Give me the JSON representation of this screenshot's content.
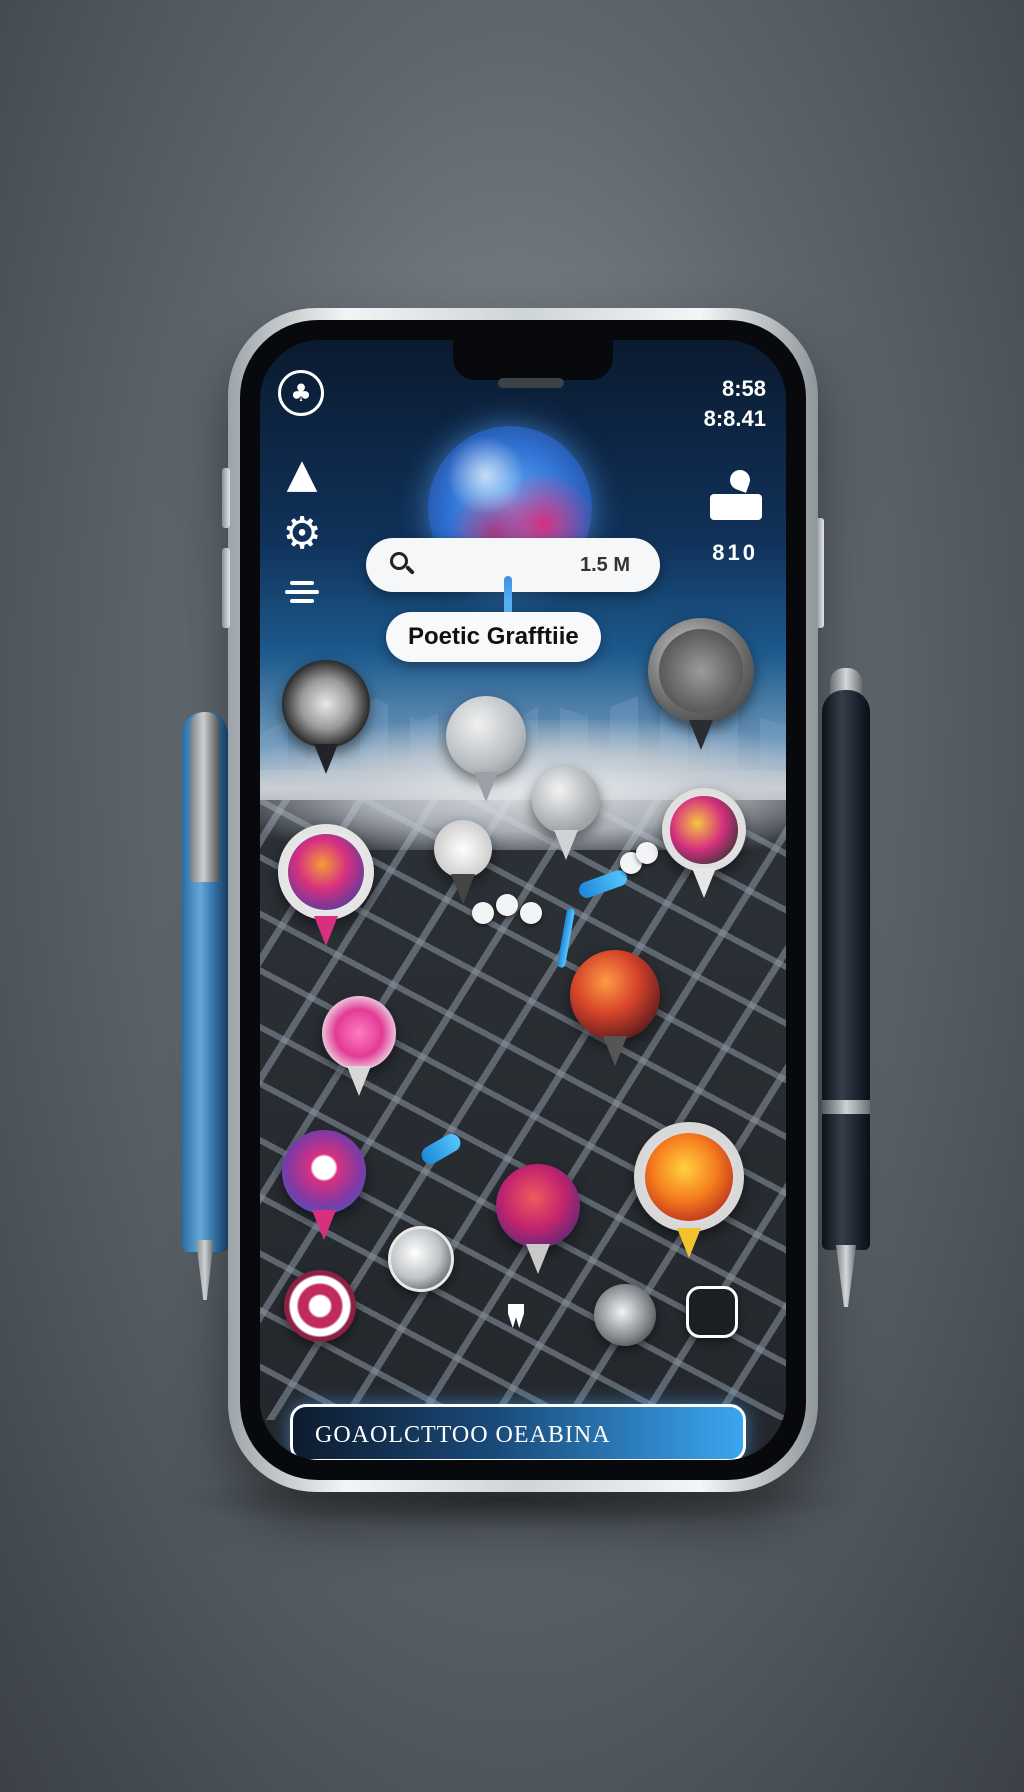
{
  "status": {
    "time_primary": "8:58",
    "time_secondary": "8:8.41",
    "indicator": "810"
  },
  "search": {
    "value": "1.5 M"
  },
  "header": {
    "title": "Poetic Grafftiie"
  },
  "cta": {
    "label": "GOAOLCTTOO OEABINA"
  },
  "icons": {
    "logo": "club-logo-icon",
    "tree": "tree-icon",
    "settings": "gear-icon",
    "menu": "menu-icon",
    "search": "search-icon",
    "profile": "user-stand-icon"
  },
  "colors": {
    "accent": "#3aa6f0",
    "magenta": "#d6307f",
    "screen_dark": "#23272c"
  }
}
